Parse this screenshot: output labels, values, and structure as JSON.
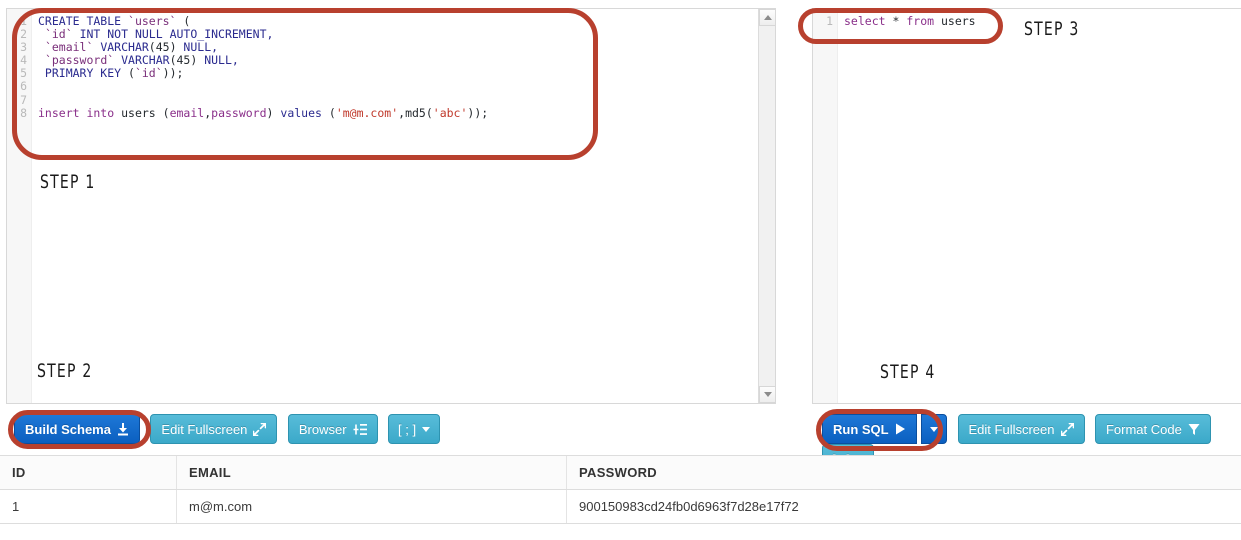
{
  "schema_editor": {
    "name": "schema-sql-editor",
    "line_numbers": [
      "1",
      "2",
      "3",
      "4",
      "5",
      "6",
      "7",
      "8"
    ],
    "lines": [
      [
        {
          "t": "CREATE TABLE ",
          "c": "kw"
        },
        {
          "t": "`users`",
          "c": "ident"
        },
        {
          "t": " (",
          "c": "plain"
        }
      ],
      [
        {
          "t": " ",
          "c": "plain"
        },
        {
          "t": "`id`",
          "c": "ident"
        },
        {
          "t": " INT NOT NULL AUTO_INCREMENT,",
          "c": "kw"
        }
      ],
      [
        {
          "t": " ",
          "c": "plain"
        },
        {
          "t": "`email`",
          "c": "ident"
        },
        {
          "t": " VARCHAR",
          "c": "kw"
        },
        {
          "t": "(45)",
          "c": "plain"
        },
        {
          "t": " NULL,",
          "c": "kw"
        }
      ],
      [
        {
          "t": " ",
          "c": "plain"
        },
        {
          "t": "`password`",
          "c": "ident"
        },
        {
          "t": " VARCHAR",
          "c": "kw"
        },
        {
          "t": "(45)",
          "c": "plain"
        },
        {
          "t": " NULL,",
          "c": "kw"
        }
      ],
      [
        {
          "t": " PRIMARY KEY ",
          "c": "kw"
        },
        {
          "t": "(",
          "c": "plain"
        },
        {
          "t": "`id`",
          "c": "ident"
        },
        {
          "t": "));",
          "c": "plain"
        }
      ],
      [],
      [],
      [
        {
          "t": "insert into",
          "c": "kw2"
        },
        {
          "t": " users ",
          "c": "plain"
        },
        {
          "t": "(",
          "c": "plain"
        },
        {
          "t": "email",
          "c": "kw2"
        },
        {
          "t": ",",
          "c": "plain"
        },
        {
          "t": "password",
          "c": "kw2"
        },
        {
          "t": ")",
          "c": "plain"
        },
        {
          "t": " ",
          "c": "plain"
        },
        {
          "t": "values",
          "c": "kw"
        },
        {
          "t": " (",
          "c": "plain"
        },
        {
          "t": "'m@m.com'",
          "c": "str"
        },
        {
          "t": ",",
          "c": "plain"
        },
        {
          "t": "md5",
          "c": "plain"
        },
        {
          "t": "(",
          "c": "plain"
        },
        {
          "t": "'abc'",
          "c": "str"
        },
        {
          "t": "));",
          "c": "plain"
        }
      ]
    ],
    "full_text": "CREATE TABLE `users` (\n `id` INT NOT NULL AUTO_INCREMENT,\n `email` VARCHAR(45) NULL,\n `password` VARCHAR(45) NULL,\n PRIMARY KEY (`id`));\n\n\ninsert into users (email,password) values ('m@m.com',md5('abc'));"
  },
  "query_editor": {
    "name": "query-sql-editor",
    "line_numbers": [
      "1"
    ],
    "lines": [
      [
        {
          "t": "select",
          "c": "kw2"
        },
        {
          "t": " ",
          "c": "plain"
        },
        {
          "t": "*",
          "c": "plain"
        },
        {
          "t": " ",
          "c": "plain"
        },
        {
          "t": "from",
          "c": "kw2"
        },
        {
          "t": " users",
          "c": "plain"
        }
      ]
    ],
    "full_text": "select * from users"
  },
  "annotations": {
    "step1": "STEP 1",
    "step2": "STEP 2",
    "step3": "STEP 3",
    "step4": "STEP 4",
    "circle_color": "#b8402e"
  },
  "schema_toolbar": {
    "build_schema": "Build Schema",
    "build_schema_icon": "download-icon",
    "edit_fullscreen": "Edit Fullscreen",
    "edit_fullscreen_icon": "expand-arrow-icon",
    "browser": "Browser",
    "browser_icon": "add-to-list-icon",
    "separator": "[ ; ]",
    "separator_icon": "chevron-down-icon"
  },
  "query_toolbar": {
    "run_sql": "Run SQL",
    "run_sql_icon": "play-icon",
    "run_sql_caret_icon": "chevron-down-icon",
    "edit_fullscreen": "Edit Fullscreen",
    "edit_fullscreen_icon": "expand-arrow-icon",
    "format_code": "Format Code",
    "format_code_icon": "filter-icon",
    "separator": "[ ; ]",
    "separator_icon": "chevron-down-icon"
  },
  "results": {
    "columns": [
      "ID",
      "EMAIL",
      "PASSWORD"
    ],
    "rows": [
      [
        "1",
        "m@m.com",
        "900150983cd24fb0d6963f7d28e17f72"
      ]
    ]
  },
  "colors": {
    "primary_button": "#0b5fc0",
    "secondary_button": "#3ba9c9",
    "annotation": "#b8402e"
  }
}
